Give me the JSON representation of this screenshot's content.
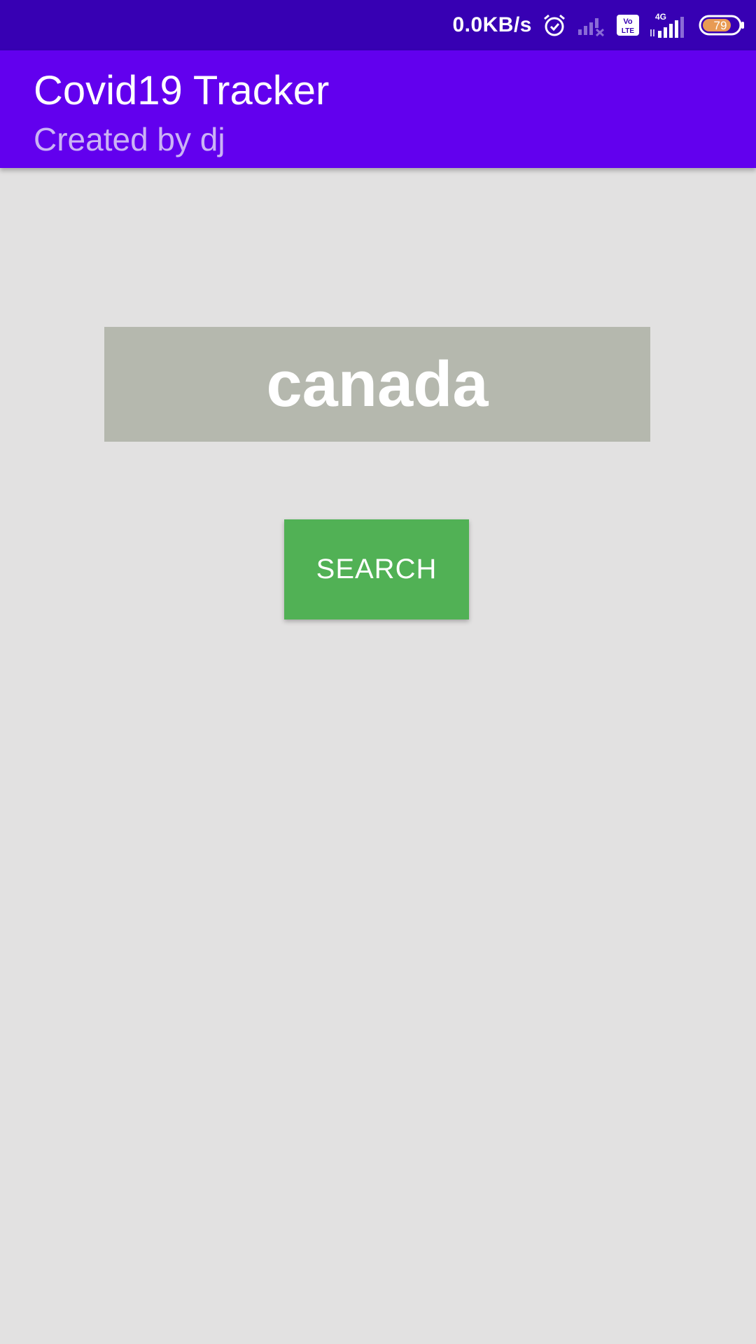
{
  "status_bar": {
    "net_speed": "0.0KB/s",
    "icons": [
      "alarm-icon",
      "signal-no-service-icon",
      "volte-icon",
      "signal-4g-icon",
      "battery-icon"
    ],
    "network_type": "4G",
    "volte_label_top": "Vo",
    "volte_label_bottom": "LTE",
    "battery_level": "79",
    "background_color": "#3700b3"
  },
  "app_bar": {
    "title": "Covid19 Tracker",
    "subtitle": "Created by dj",
    "background_color": "#6200ee"
  },
  "search": {
    "input_value": "canada",
    "button_label": "SEARCH",
    "input_background": "#b5b8ae",
    "button_color": "#51b155"
  }
}
